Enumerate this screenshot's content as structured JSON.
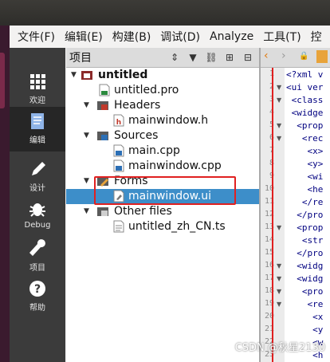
{
  "menu": [
    "文件(F)",
    "编辑(E)",
    "构建(B)",
    "调试(D)",
    "Analyze",
    "工具(T)",
    "控"
  ],
  "modes": [
    {
      "label": "欢迎",
      "icon": "grid-icon"
    },
    {
      "label": "编辑",
      "icon": "edit-doc-icon"
    },
    {
      "label": "设计",
      "icon": "pencil-icon"
    },
    {
      "label": "Debug",
      "icon": "bug-icon"
    },
    {
      "label": "项目",
      "icon": "wrench-icon"
    },
    {
      "label": "帮助",
      "icon": "help-icon"
    }
  ],
  "panel": {
    "title": "项目"
  },
  "tree": [
    {
      "label": "untitled",
      "level": 0,
      "arrow": "▼",
      "icon": "project-icon",
      "bold": true
    },
    {
      "label": "untitled.pro",
      "level": 1,
      "arrow": "",
      "icon": "pro-file-icon"
    },
    {
      "label": "Headers",
      "level": 1,
      "arrow": "▼",
      "icon": "headers-folder-icon"
    },
    {
      "label": "mainwindow.h",
      "level": 2,
      "arrow": "",
      "icon": "header-file-icon"
    },
    {
      "label": "Sources",
      "level": 1,
      "arrow": "▼",
      "icon": "sources-folder-icon"
    },
    {
      "label": "main.cpp",
      "level": 2,
      "arrow": "",
      "icon": "cpp-file-icon"
    },
    {
      "label": "mainwindow.cpp",
      "level": 2,
      "arrow": "",
      "icon": "cpp-file-icon"
    },
    {
      "label": "Forms",
      "level": 1,
      "arrow": "▼",
      "icon": "forms-folder-icon"
    },
    {
      "label": "mainwindow.ui",
      "level": 2,
      "arrow": "",
      "icon": "ui-file-icon",
      "selected": true
    },
    {
      "label": "Other files",
      "level": 1,
      "arrow": "▼",
      "icon": "other-folder-icon"
    },
    {
      "label": "untitled_zh_CN.ts",
      "level": 2,
      "arrow": "",
      "icon": "ts-file-icon"
    }
  ],
  "code_lines": [
    "<?xml v",
    "<ui ver",
    " <class",
    " <widge",
    "  <prop",
    "   <rec",
    "    <x>",
    "    <y>",
    "    <wi",
    "    <he",
    "   </re",
    "  </pro",
    "  <prop",
    "   <str",
    "  </pro",
    "  <widg",
    "  <widg",
    "   <pro",
    "    <re",
    "     <x",
    "     <y",
    "     <w",
    "     <h"
  ],
  "watermark": "CSDN @秋星2130"
}
